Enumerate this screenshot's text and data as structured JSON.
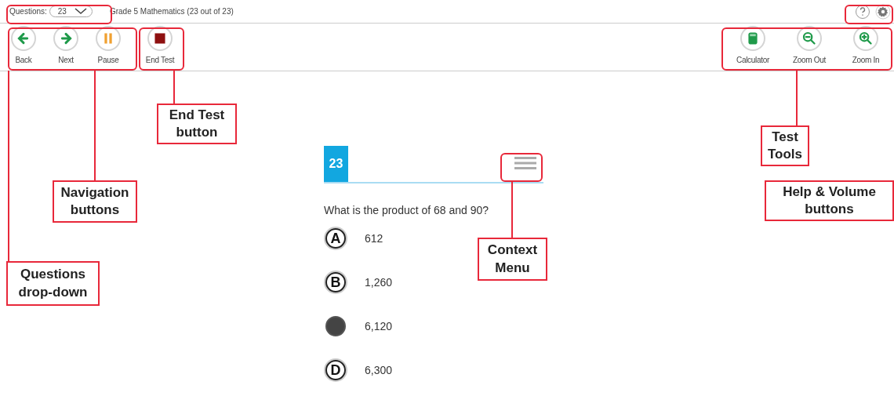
{
  "top_bar": {
    "questions_label": "Questions:",
    "questions_value": "23",
    "title": "Grade 5 Mathematics (23 out of 23)"
  },
  "toolbar_left": [
    {
      "kind": "back",
      "label": "Back"
    },
    {
      "kind": "next",
      "label": "Next"
    },
    {
      "kind": "pause",
      "label": "Pause"
    },
    {
      "kind": "end",
      "label": "End Test"
    }
  ],
  "toolbar_right": [
    {
      "kind": "calculator",
      "label": "Calculator"
    },
    {
      "kind": "zoom-out",
      "label": "Zoom Out"
    },
    {
      "kind": "zoom-in",
      "label": "Zoom In"
    }
  ],
  "question": {
    "number": "23",
    "text": "What is the product of 68 and 90?",
    "options": [
      {
        "letter": "A",
        "text": "612",
        "selected": false
      },
      {
        "letter": "B",
        "text": "1,260",
        "selected": false
      },
      {
        "text": "6,120",
        "selected": true
      },
      {
        "letter": "D",
        "text": "6,300",
        "selected": false
      }
    ]
  },
  "callouts": [
    {
      "label": "End Test button"
    },
    {
      "label": "Navigation buttons"
    },
    {
      "label": "Test Tools"
    },
    {
      "label": "Help & Volume buttons"
    },
    {
      "label": "Context Menu"
    },
    {
      "label": "Questions drop-down"
    }
  ]
}
